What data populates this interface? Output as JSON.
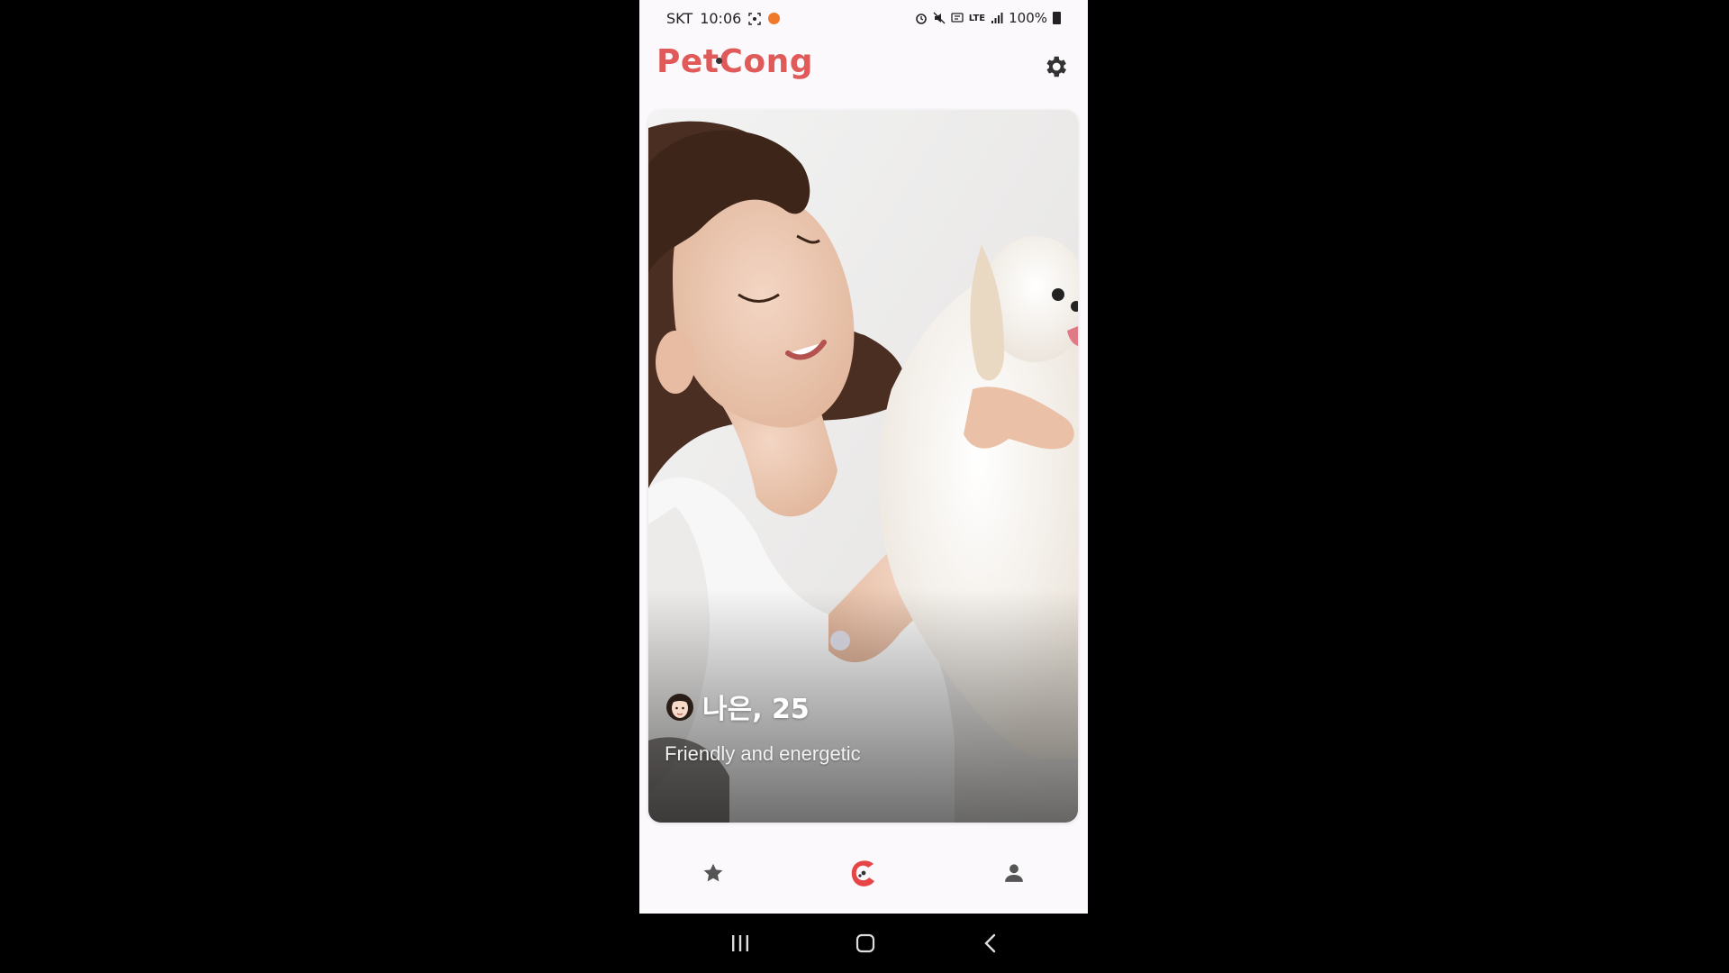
{
  "status_bar": {
    "carrier": "SKT",
    "time": "10:06",
    "lte": "LTE",
    "battery": "100%"
  },
  "app": {
    "logo_text": "PetCong",
    "brand_color": "#e05a5a"
  },
  "profile_card": {
    "name": "나은, 25",
    "bio": "Friendly and energetic",
    "avatar_icon": "woman-emoji-icon"
  },
  "bottom_nav": {
    "items": [
      "star-icon",
      "petcong-logo-icon",
      "person-icon"
    ],
    "active_color": "#e64545",
    "inactive_color": "#555555"
  }
}
